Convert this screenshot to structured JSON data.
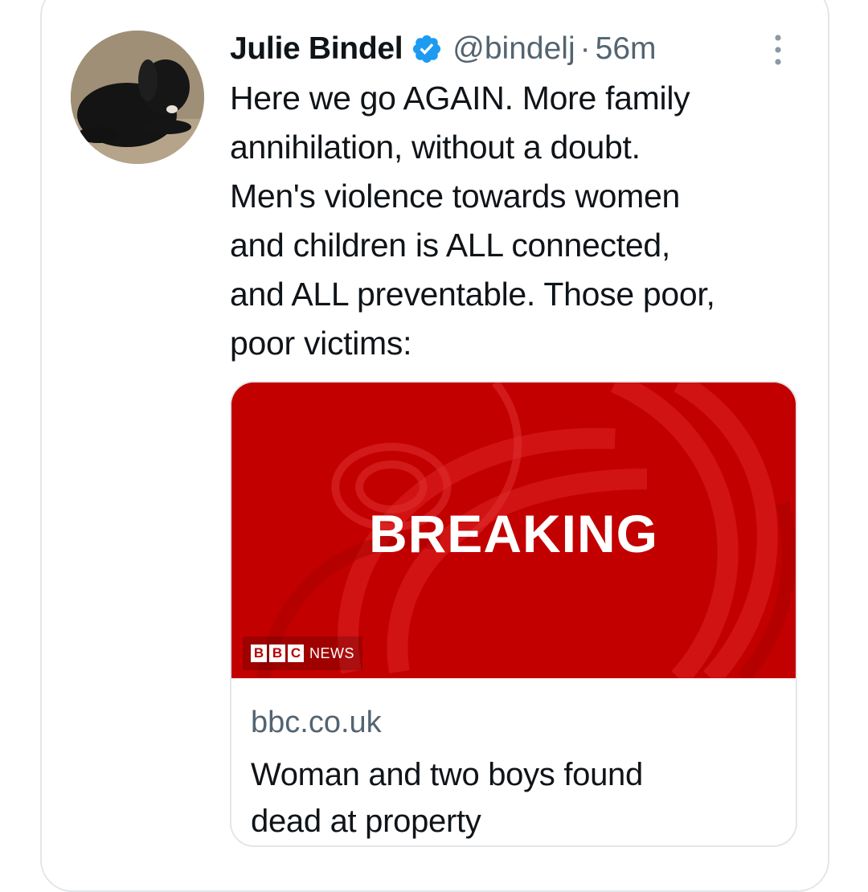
{
  "tweet": {
    "author_name": "Julie Bindel",
    "verified_icon": "verified-badge-icon",
    "handle": "@bindelj",
    "separator": "·",
    "time": "56m",
    "more_icon": "more-options-icon",
    "text_lines": [
      "Here we go AGAIN. More family",
      "annihilation, without a doubt.",
      "Men's violence towards women",
      "and children is ALL connected,",
      "and ALL preventable. Those poor,",
      "poor victims:"
    ]
  },
  "card": {
    "image_text": "BREAKING",
    "logo_letters": [
      "B",
      "B",
      "C"
    ],
    "logo_word": "NEWS",
    "domain": "bbc.co.uk",
    "headline_lines": [
      "Woman and two boys found",
      "dead at property"
    ]
  },
  "colors": {
    "text": "#0f1419",
    "muted": "#536471",
    "verified": "#1d9bf0",
    "bbc_red": "#c40000",
    "border": "#e3e6e9"
  }
}
